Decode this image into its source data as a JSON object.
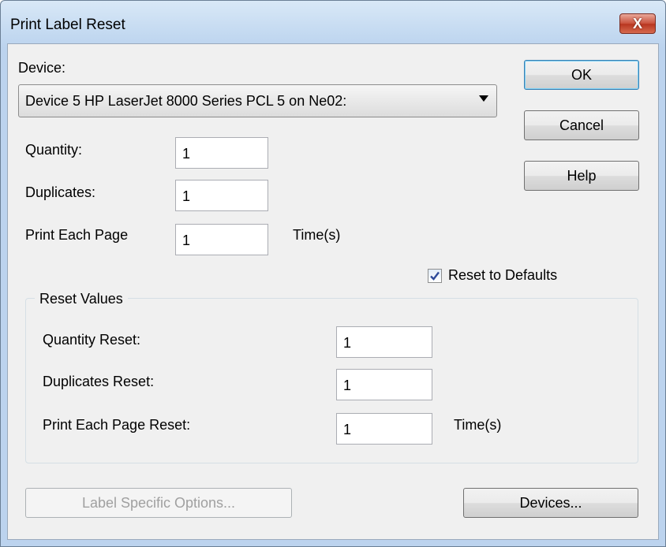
{
  "window": {
    "title": "Print Label Reset",
    "close_label": "X"
  },
  "device": {
    "label": "Device:",
    "selected": "Device 5  HP LaserJet 8000 Series PCL 5 on Ne02:"
  },
  "fields": {
    "quantity_label": "Quantity:",
    "quantity_value": "1",
    "duplicates_label": "Duplicates:",
    "duplicates_value": "1",
    "print_each_page_label": "Print Each Page",
    "print_each_page_value": "1",
    "times_label": "Time(s)"
  },
  "buttons": {
    "ok": "OK",
    "cancel": "Cancel",
    "help": "Help",
    "label_specific_options": "Label Specific Options...",
    "devices": "Devices..."
  },
  "reset_defaults": {
    "label": "Reset to Defaults",
    "checked": true
  },
  "reset_values": {
    "group_title": "Reset Values",
    "quantity_reset_label": "Quantity Reset:",
    "quantity_reset_value": "1",
    "duplicates_reset_label": "Duplicates Reset:",
    "duplicates_reset_value": "1",
    "print_each_page_reset_label": "Print Each Page Reset:",
    "print_each_page_reset_value": "1",
    "times_label": "Time(s)"
  },
  "icons": {
    "close": "close-icon",
    "dropdown": "chevron-down-icon",
    "check": "checkmark-icon"
  },
  "colors": {
    "close_button": "#c9503b",
    "title_bar": "#c4daf1",
    "dialog_face": "#f0f0f0",
    "check": "#2c4a9a"
  }
}
